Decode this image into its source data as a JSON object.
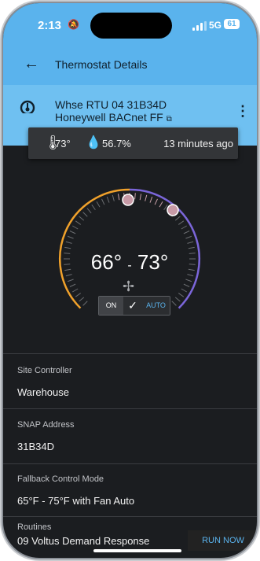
{
  "status_bar": {
    "time": "2:13",
    "network": "5G",
    "battery": "61"
  },
  "app_bar": {
    "title": "Thermostat Details",
    "back_icon": "arrow-left-icon"
  },
  "device": {
    "name": "Whse RTU 04 31B34D Honeywell BACnet FF",
    "icon": "thermostat-icon",
    "menu_icon": "more-vert-icon"
  },
  "readings": {
    "temperature": "73°",
    "humidity": "56.7%",
    "updated": "13 minutes ago"
  },
  "dial": {
    "heat_setpoint": "66",
    "cool_setpoint": "73",
    "degree_symbol": "°",
    "separator": "-",
    "heat_color": "#f0a12b",
    "cool_color": "#7b66d9"
  },
  "fan_mode": {
    "on_label": "ON",
    "auto_label": "AUTO",
    "selected": "AUTO"
  },
  "fields": [
    {
      "label": "Site Controller",
      "value": "Warehouse"
    },
    {
      "label": "SNAP Address",
      "value": "31B34D"
    },
    {
      "label": "Fallback Control Mode",
      "value": "65°F - 75°F with Fan Auto"
    }
  ],
  "routines": {
    "label": "Routines",
    "item_name": "09 Voltus Demand Response",
    "action": "RUN NOW"
  }
}
